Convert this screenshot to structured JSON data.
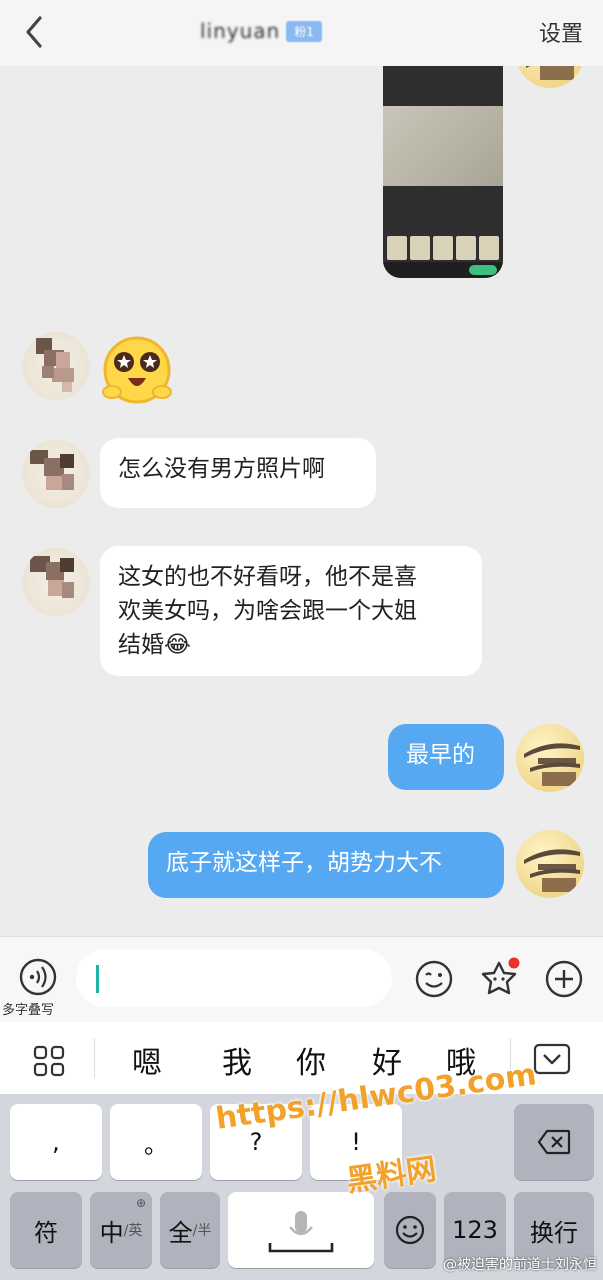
{
  "header": {
    "title": "linyuan",
    "badge": "粉1",
    "settings_label": "设置",
    "icons": {
      "back": "chevron-left-icon"
    }
  },
  "messages": [
    {
      "side": "self",
      "type": "image",
      "content": "screenshot photo of document"
    },
    {
      "side": "other",
      "type": "sticker",
      "content": "starry-eyes emoji"
    },
    {
      "side": "other",
      "type": "text",
      "lines": [
        "怎么没有男方照片啊"
      ]
    },
    {
      "side": "other",
      "type": "text",
      "lines": [
        "这女的也不好看呀，他不是喜",
        "欢美女吗，为啥会跟一个大姐",
        "结婚😂"
      ]
    },
    {
      "side": "self",
      "type": "text",
      "lines": [
        "最早的"
      ]
    },
    {
      "side": "self",
      "type": "text",
      "lines": [
        "底子就这样子，胡势力大不"
      ]
    }
  ],
  "input_bar": {
    "voice_label": "多字叠写",
    "input_value": "",
    "icons": {
      "voice": "voice-input-icon",
      "emoji": "emoji-icon",
      "sticker": "star-sticker-icon",
      "plus": "plus-icon"
    }
  },
  "candidates": [
    "嗯",
    "我",
    "你",
    "好",
    "哦"
  ],
  "keyboard": {
    "row1": [
      ",",
      "。",
      "?",
      "!"
    ],
    "row2": {
      "symbol": "符",
      "cn_main": "中",
      "cn_sub": "/英",
      "full_main": "全",
      "full_sub": "/半",
      "numbers": "123",
      "enter": "换行"
    }
  },
  "watermark": {
    "url": "https://hlwc03.com",
    "name": "黑料网"
  },
  "credit": "@被迫害的前道士刘永恒",
  "colors": {
    "bubble_out": "#57a8f2",
    "bubble_in": "#ffffff",
    "background": "#ececec",
    "caret": "#1fb3a5",
    "watermark": "#f2a12a"
  }
}
